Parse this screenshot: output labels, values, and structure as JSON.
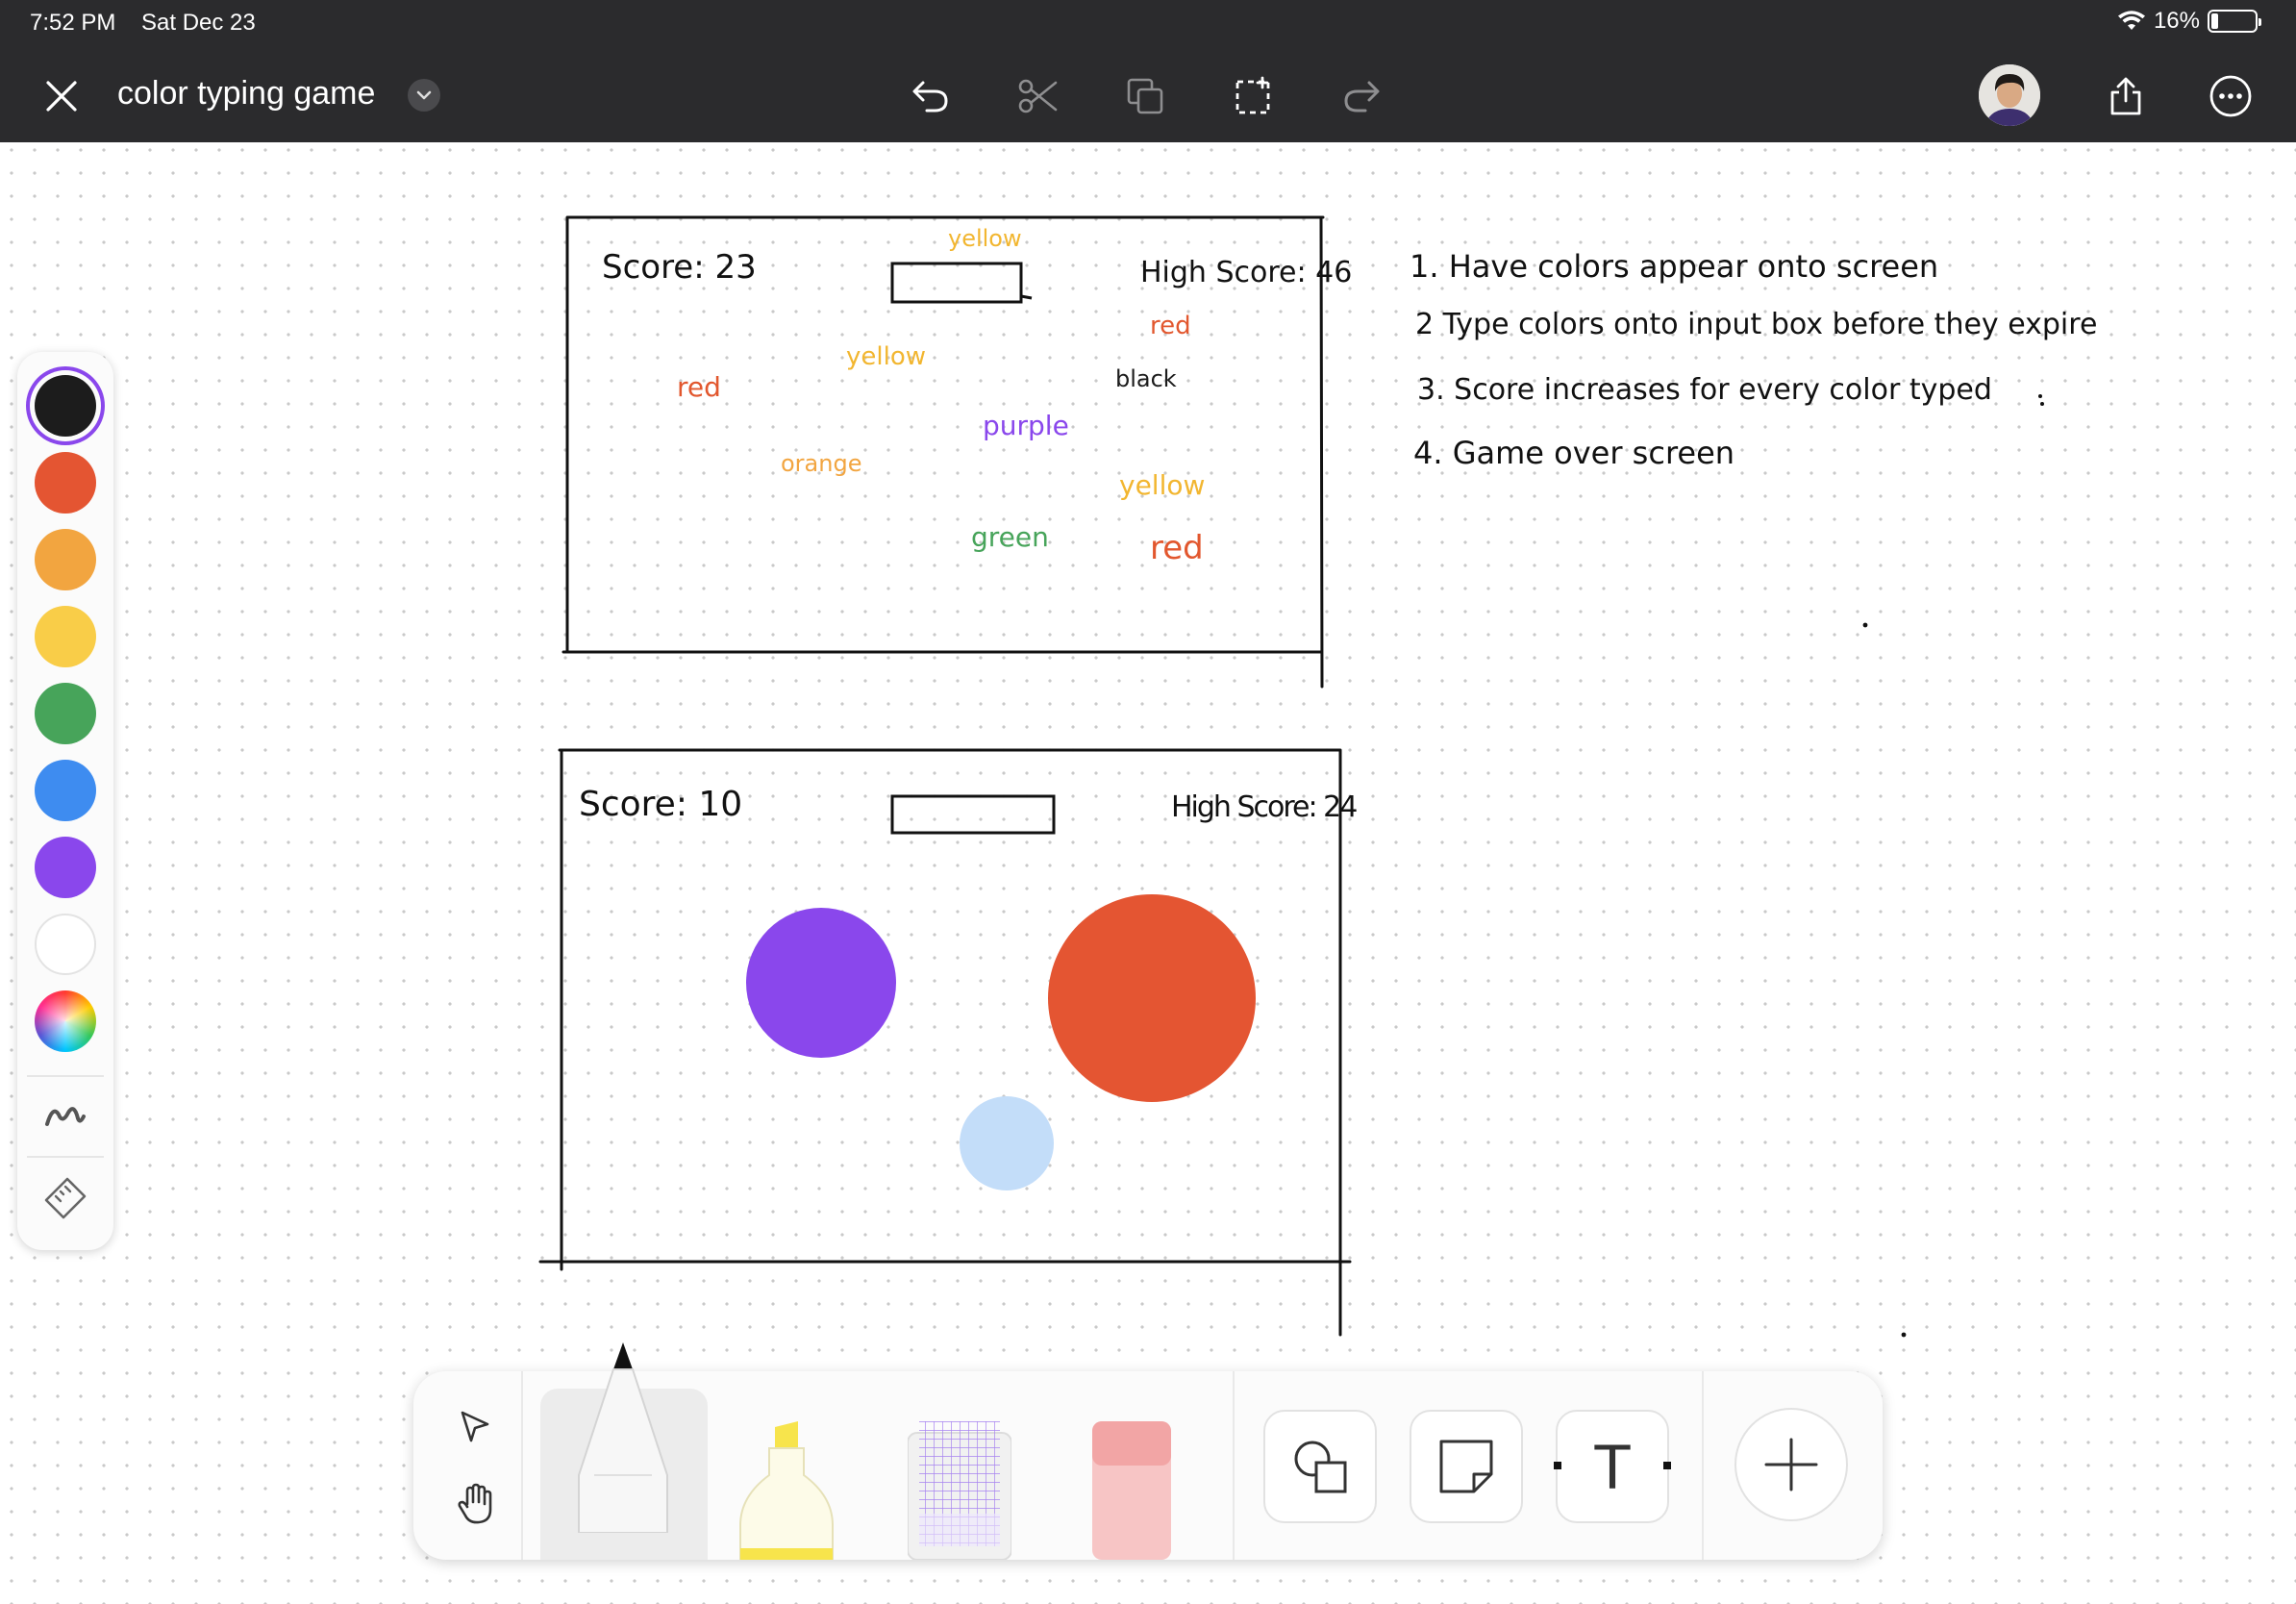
{
  "status_bar": {
    "time": "7:52 PM",
    "date": "Sat Dec 23",
    "battery_text": "16%",
    "battery_level": 0.16
  },
  "toolbar_top": {
    "document_title": "color typing game",
    "icons": [
      "close-icon",
      "chevron-down-icon",
      "undo-icon",
      "scissors-icon",
      "duplicate-icon",
      "selection-icon",
      "redo-icon",
      "avatar",
      "share-icon",
      "more-icon"
    ]
  },
  "palette": {
    "colors": [
      "#1c1c1c",
      "#e45532",
      "#f2a540",
      "#f9cd48",
      "#47a45a",
      "#3e8cf0",
      "#8a47ec",
      "#ffffff"
    ],
    "selected_index": 0,
    "accent": "#8a47ec"
  },
  "canvas": {
    "frame1": {
      "score": "Score: 23",
      "high_score": "High Score: 46",
      "words": [
        {
          "text": "yellow",
          "color": "#f2b630"
        },
        {
          "text": "red",
          "color": "#e2572e"
        },
        {
          "text": "yellow",
          "color": "#f2b630"
        },
        {
          "text": "black",
          "color": "#1c1c1c"
        },
        {
          "text": "red",
          "color": "#e2572e"
        },
        {
          "text": "purple",
          "color": "#8a47ec"
        },
        {
          "text": "orange",
          "color": "#f2a540"
        },
        {
          "text": "yellow",
          "color": "#f2b630"
        },
        {
          "text": "green",
          "color": "#47a45a"
        },
        {
          "text": "red",
          "color": "#e2572e"
        }
      ]
    },
    "frame2": {
      "score": "Score: 10",
      "high_score": "High Score: 24",
      "circle_colors": [
        "#8a47ec",
        "#e45532",
        "#c3ddf9"
      ]
    },
    "notes": [
      "1. Have colors appear onto screen",
      "2 Type colors onto input box before they expire",
      "3. Score increases for every color typed",
      "4. Game over screen"
    ]
  },
  "bottom_toolbar": {
    "tools": [
      "select-icon",
      "hand-icon",
      "pen-tool",
      "highlighter-tool",
      "grid-tool",
      "eraser-tool",
      "shapes-button",
      "sticky-note-button",
      "text-box-button",
      "add-button"
    ],
    "text_tool_label": "T"
  }
}
